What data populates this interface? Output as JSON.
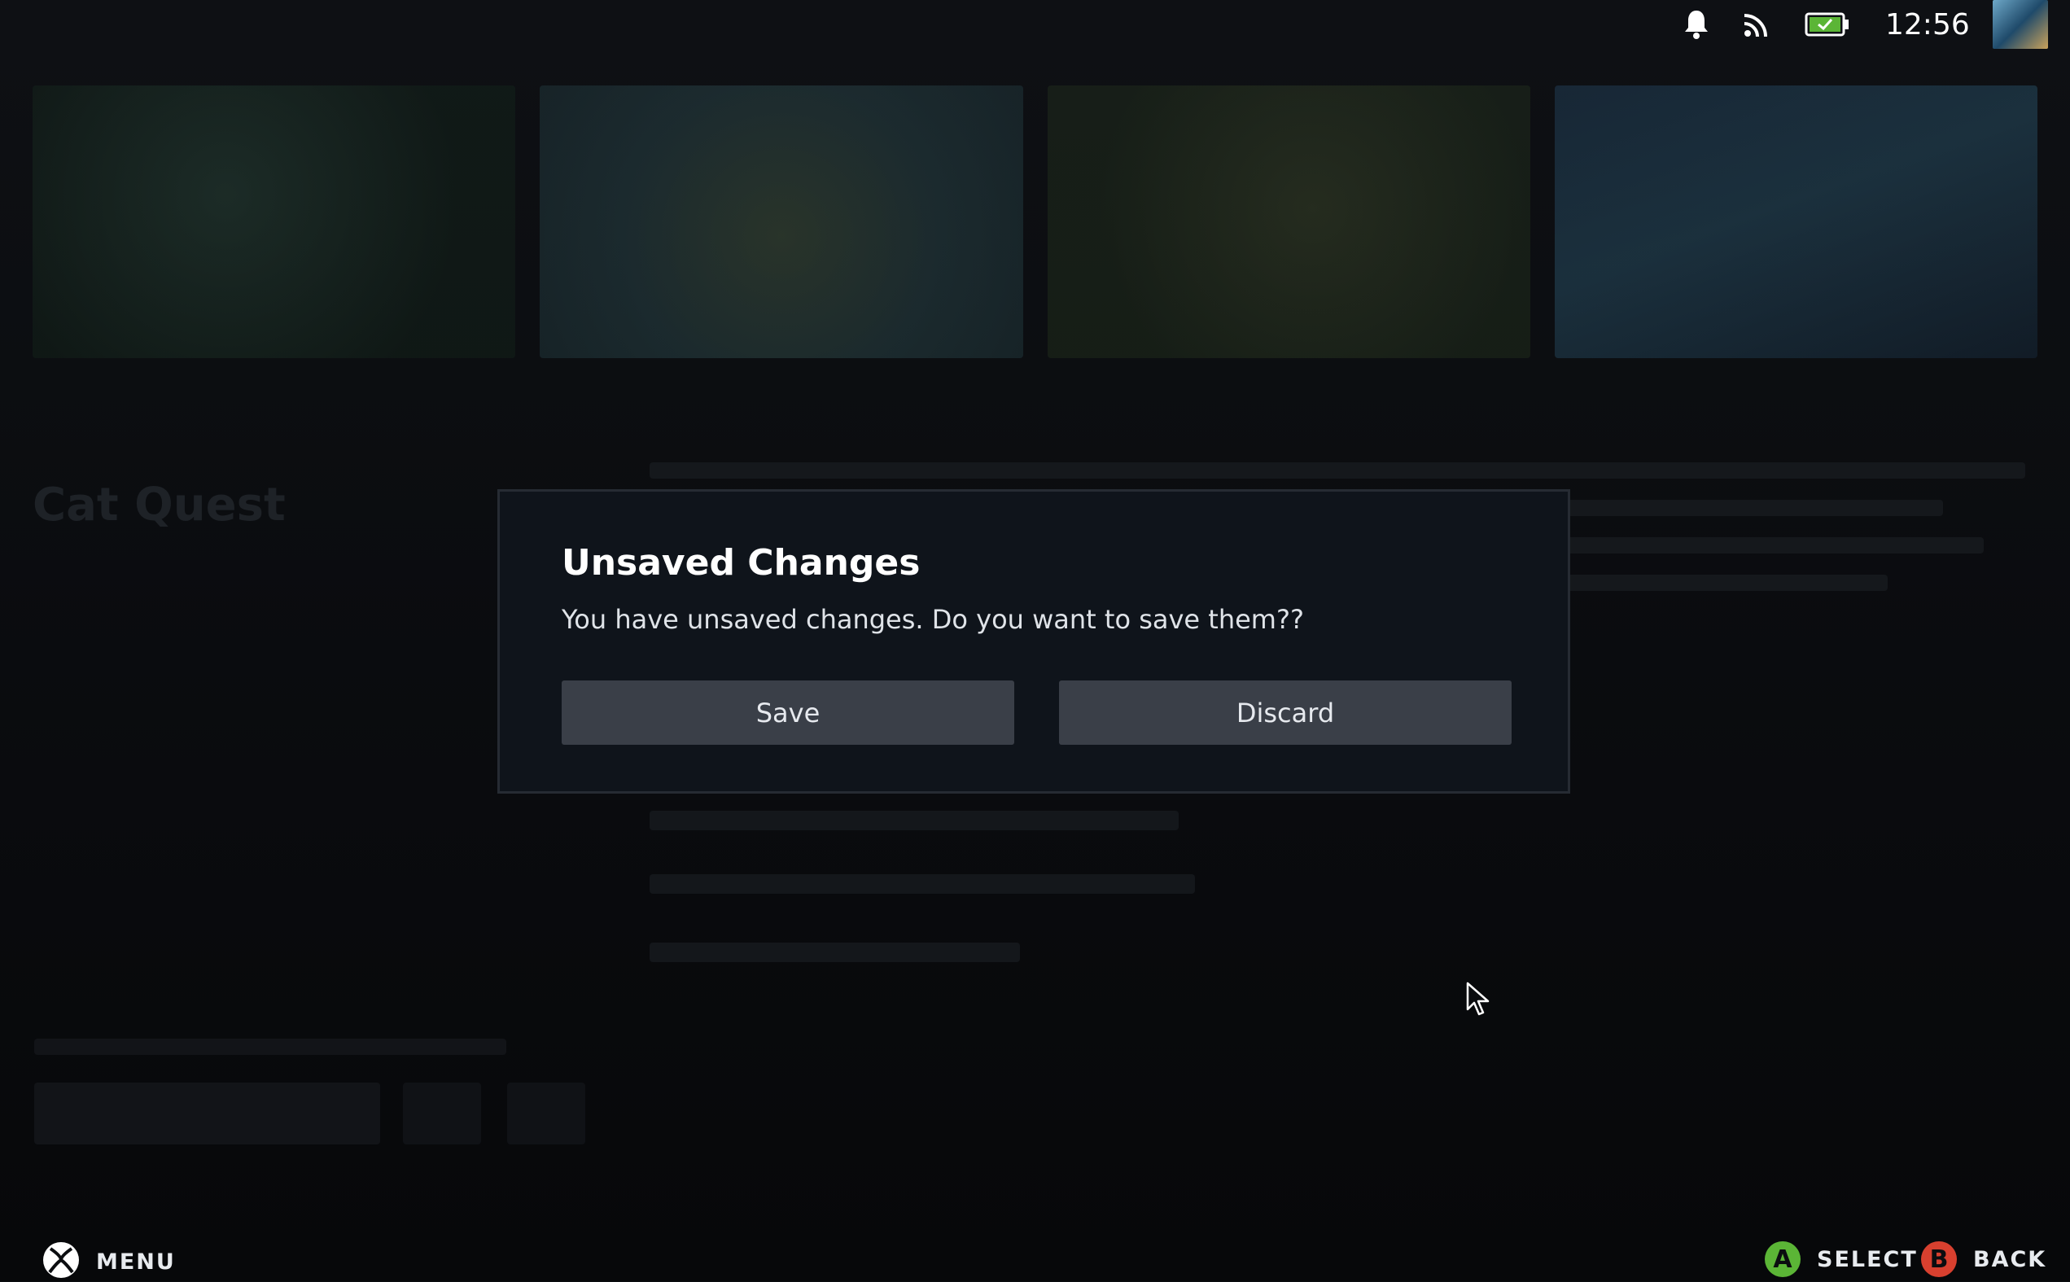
{
  "status_bar": {
    "clock": "12:56",
    "icons": [
      "bell-icon",
      "wifi-icon",
      "battery-charging-icon"
    ]
  },
  "background": {
    "game_title": "Cat Quest"
  },
  "dialog": {
    "title": "Unsaved Changes",
    "message": "You have unsaved changes. Do you want to save them??",
    "save_label": "Save",
    "discard_label": "Discard"
  },
  "footer": {
    "menu_label": "MENU",
    "select_label": "SELECT",
    "select_badge": "A",
    "back_label": "BACK",
    "back_badge": "B"
  },
  "colors": {
    "accent_a": "#5bb536",
    "accent_b": "#d8402f",
    "dialog_bg": "#0f141b",
    "button_bg": "#3a3f48"
  }
}
